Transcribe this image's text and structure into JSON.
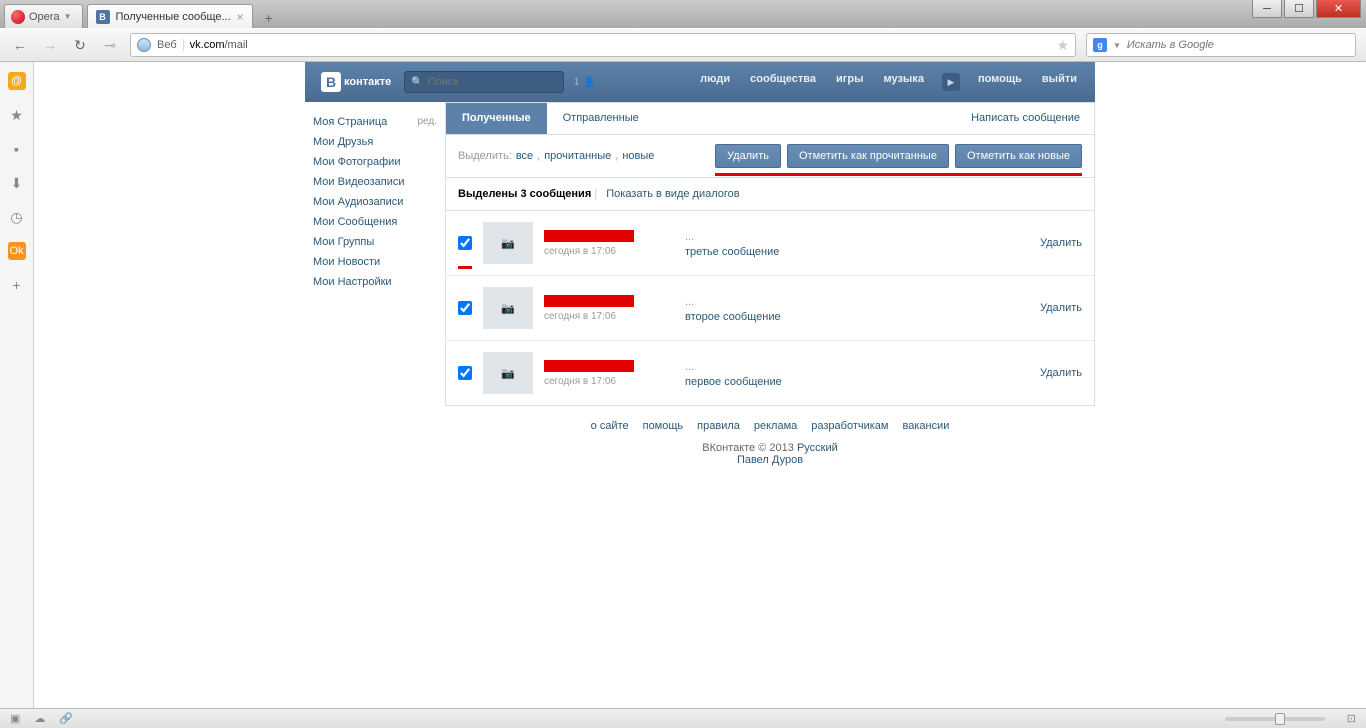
{
  "browser": {
    "opera_label": "Opera",
    "tab_title": "Полученные сообще...",
    "url_label": "Веб",
    "url_host": "vk.com",
    "url_path": "/mail",
    "search_placeholder": "Искать в Google"
  },
  "vk_header": {
    "logo": "контакте",
    "search_placeholder": "Поиск",
    "search_count": "1",
    "nav": [
      "люди",
      "сообщества",
      "игры",
      "музыка"
    ],
    "nav2": [
      "помощь",
      "выйти"
    ]
  },
  "sidebar": {
    "items": [
      "Моя Страница",
      "Мои Друзья",
      "Мои Фотографии",
      "Мои Видеозаписи",
      "Мои Аудиозаписи",
      "Мои Сообщения",
      "Мои Группы",
      "Мои Новости",
      "Мои Настройки"
    ],
    "edit": "ред."
  },
  "tabs": {
    "received": "Полученные",
    "sent": "Отправленные",
    "compose": "Написать сообщение"
  },
  "filter": {
    "label": "Выделить:",
    "all": "все",
    "read": "прочитанные",
    "new": "новые",
    "btn_delete": "Удалить",
    "btn_mark_read": "Отметить как прочитанные",
    "btn_mark_new": "Отметить как новые"
  },
  "selection": {
    "text": "Выделены 3 сообщения",
    "show_dialogs": "Показать в виде диалогов"
  },
  "messages": [
    {
      "date": "сегодня в 17:06",
      "preview": "третье сообщение",
      "delete": "Удалить"
    },
    {
      "date": "сегодня в 17:06",
      "preview": "второе сообщение",
      "delete": "Удалить"
    },
    {
      "date": "сегодня в 17:06",
      "preview": "первое сообщение",
      "delete": "Удалить"
    }
  ],
  "footer": {
    "links": [
      "о сайте",
      "помощь",
      "правила",
      "реклама",
      "разработчикам",
      "вакансии"
    ],
    "copy": "ВКонтакте © 2013",
    "lang": "Русский",
    "author": "Павел Дуров"
  }
}
